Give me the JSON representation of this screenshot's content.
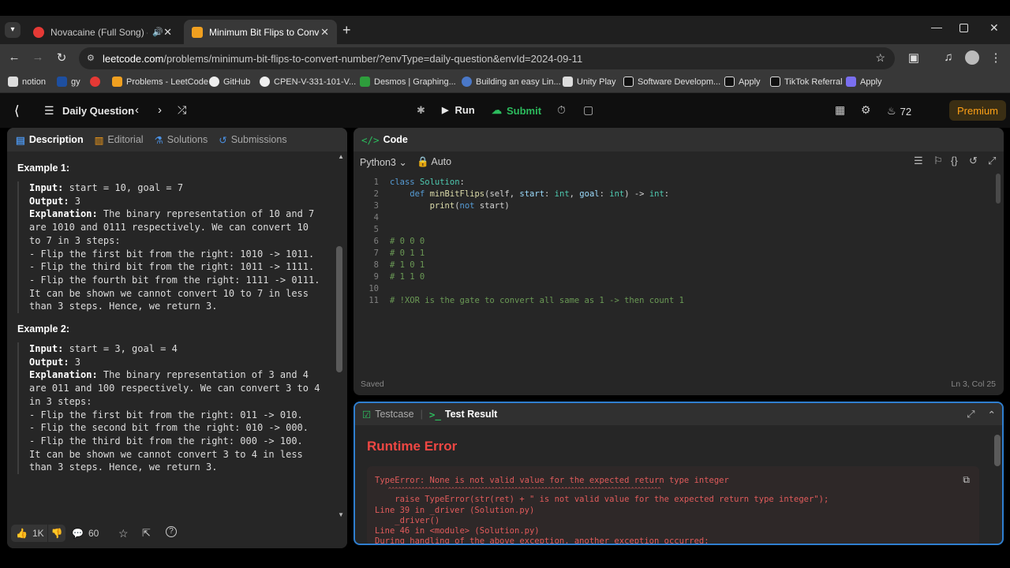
{
  "browser": {
    "tabs": [
      {
        "title": "Novacaine (Full Song) - You",
        "active": false
      },
      {
        "title": "Minimum Bit Flips to Convert N",
        "active": true
      }
    ],
    "url_host": "leetcode.com",
    "url_path": "/problems/minimum-bit-flips-to-convert-number/?envType=daily-question&envId=2024-09-11",
    "bookmarks": [
      "notion",
      "gy",
      "",
      "Problems - LeetCode",
      "GitHub",
      "CPEN-V-331-101-V...",
      "Desmos | Graphing...",
      "Building an easy Lin...",
      "Unity Play",
      "Software Developm...",
      "Apply",
      "TikTok Referral",
      "Apply"
    ]
  },
  "lc": {
    "daily": "Daily Question",
    "run": "Run",
    "submit": "Submit",
    "streak": "72",
    "premium": "Premium"
  },
  "left": {
    "tabs": [
      "Description",
      "Editorial",
      "Solutions",
      "Submissions"
    ],
    "ex1_title": "Example 1:",
    "ex1_lines": [
      {
        "b": "Input:",
        "t": " start = 10, goal = 7"
      },
      {
        "b": "Output:",
        "t": " 3"
      },
      {
        "b": "Explanation:",
        "t": " The binary representation of 10 and 7 are 1010 and 0111 respectively. We can convert 10 to 7 in 3 steps:\n- Flip the first bit from the right: 1010 -> 1011.\n- Flip the third bit from the right: 1011 -> 1111.\n- Flip the fourth bit from the right: 1111 -> 0111.\nIt can be shown we cannot convert 10 to 7 in less than 3 steps. Hence, we return 3."
      }
    ],
    "ex2_title": "Example 2:",
    "ex2_lines": [
      {
        "b": "Input:",
        "t": " start = 3, goal = 4"
      },
      {
        "b": "Output:",
        "t": " 3"
      },
      {
        "b": "Explanation:",
        "t": " The binary representation of 3 and 4 are 011 and 100 respectively. We can convert 3 to 4 in 3 steps:\n- Flip the first bit from the right: 011 -> 010.\n- Flip the second bit from the right: 010 -> 000.\n- Flip the third bit from the right: 000 -> 100.\nIt can be shown we cannot convert 3 to 4 in less than 3 steps. Hence, we return 3."
      }
    ],
    "likes": "1K",
    "comments": "60"
  },
  "code": {
    "header": "Code",
    "language": "Python3",
    "mode": "Auto",
    "saved": "Saved",
    "cursor": "Ln 3, Col 25",
    "lines": [
      {
        "n": "1",
        "tokens": [
          [
            "kw",
            "class "
          ],
          [
            "cls",
            "Solution"
          ],
          [
            "tx",
            ":"
          ]
        ]
      },
      {
        "n": "2",
        "tokens": [
          [
            "tx",
            "    "
          ],
          [
            "kw",
            "def "
          ],
          [
            "fn",
            "minBitFlips"
          ],
          [
            "tx",
            "(self, "
          ],
          [
            "prm",
            "start"
          ],
          [
            "tx",
            ": "
          ],
          [
            "cls",
            "int"
          ],
          [
            "tx",
            ", "
          ],
          [
            "prm",
            "goal"
          ],
          [
            "tx",
            ": "
          ],
          [
            "cls",
            "int"
          ],
          [
            "tx",
            ") -> "
          ],
          [
            "cls",
            "int"
          ],
          [
            "tx",
            ":"
          ]
        ]
      },
      {
        "n": "3",
        "tokens": [
          [
            "tx",
            "        "
          ],
          [
            "fn",
            "print"
          ],
          [
            "tx",
            "("
          ],
          [
            "kw",
            "not "
          ],
          [
            "tx",
            "start)"
          ]
        ]
      },
      {
        "n": "4",
        "tokens": []
      },
      {
        "n": "5",
        "tokens": []
      },
      {
        "n": "6",
        "tokens": [
          [
            "cm",
            "# 0 0 0"
          ]
        ]
      },
      {
        "n": "7",
        "tokens": [
          [
            "cm",
            "# 0 1 1"
          ]
        ]
      },
      {
        "n": "8",
        "tokens": [
          [
            "cm",
            "# 1 0 1"
          ]
        ]
      },
      {
        "n": "9",
        "tokens": [
          [
            "cm",
            "# 1 1 0"
          ]
        ]
      },
      {
        "n": "10",
        "tokens": []
      },
      {
        "n": "11",
        "tokens": [
          [
            "cm",
            "# !XOR is the gate to convert all same as 1 -> then count 1"
          ]
        ]
      }
    ]
  },
  "result": {
    "tabs": [
      "Testcase",
      "Test Result"
    ],
    "status": "Runtime Error",
    "error_lines": [
      "TypeError: None is not valid value for the expected return type integer",
      "    ^^^^^^^^^^^^^^^^^^^^^^^^^^^^^^^^^^^^^^^^^^^^^^^^^^^^^^^^^^^^^^^^^^^^^^^^^^^^^^^^^^",
      "    raise TypeError(str(ret) + \" is not valid value for the expected return type integer\");",
      "Line 39 in _driver (Solution.py)",
      "    _driver()",
      "Line 46 in <module> (Solution.py)",
      "During handling of the above exception, another exception occurred:"
    ]
  }
}
